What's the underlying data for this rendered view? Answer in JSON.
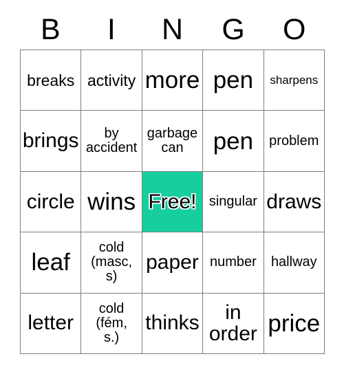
{
  "card": {
    "title": "BINGO",
    "header_letters": [
      "B",
      "I",
      "N",
      "G",
      "O"
    ],
    "grid_size": "5x5",
    "free_space_label": "Free!",
    "free_space_position": "N3",
    "colors": {
      "marked_cell": "#16ce9e",
      "grid_line": "#7d7d7d",
      "cell_background": "#ffffff",
      "text": "#000000"
    },
    "rows": [
      [
        {
          "text": "breaks",
          "size": "sz-m",
          "marked": false
        },
        {
          "text": "activity",
          "size": "sz-m",
          "marked": false
        },
        {
          "text": "more",
          "size": "sz-xxl",
          "marked": false
        },
        {
          "text": "pen",
          "size": "sz-xxl",
          "marked": false
        },
        {
          "text": "sharpens",
          "size": "sz-xs",
          "marked": false
        }
      ],
      [
        {
          "text": "brings",
          "size": "sz-xl",
          "marked": false
        },
        {
          "text": "by\naccident",
          "size": "sz-s",
          "marked": false
        },
        {
          "text": "garbage\ncan",
          "size": "sz-s",
          "marked": false
        },
        {
          "text": "pen",
          "size": "sz-xxl",
          "marked": false
        },
        {
          "text": "problem",
          "size": "sz-s",
          "marked": false
        }
      ],
      [
        {
          "text": "circle",
          "size": "sz-xl",
          "marked": false
        },
        {
          "text": "wins",
          "size": "sz-xxl",
          "marked": false
        },
        {
          "text": "Free!",
          "size": "sz-xl",
          "marked": true
        },
        {
          "text": "singular",
          "size": "sz-s",
          "marked": false
        },
        {
          "text": "draws",
          "size": "sz-xl",
          "marked": false
        }
      ],
      [
        {
          "text": "leaf",
          "size": "sz-xxl",
          "marked": false
        },
        {
          "text": "cold\n(masc,\ns)",
          "size": "sz-s",
          "marked": false
        },
        {
          "text": "paper",
          "size": "sz-xl",
          "marked": false
        },
        {
          "text": "number",
          "size": "sz-s",
          "marked": false
        },
        {
          "text": "hallway",
          "size": "sz-s",
          "marked": false
        }
      ],
      [
        {
          "text": "letter",
          "size": "sz-xl",
          "marked": false
        },
        {
          "text": "cold\n(fém,\ns.)",
          "size": "sz-s",
          "marked": false
        },
        {
          "text": "thinks",
          "size": "sz-xl",
          "marked": false
        },
        {
          "text": "in\norder",
          "size": "sz-xl",
          "marked": false
        },
        {
          "text": "price",
          "size": "sz-xxl",
          "marked": false
        }
      ]
    ]
  }
}
